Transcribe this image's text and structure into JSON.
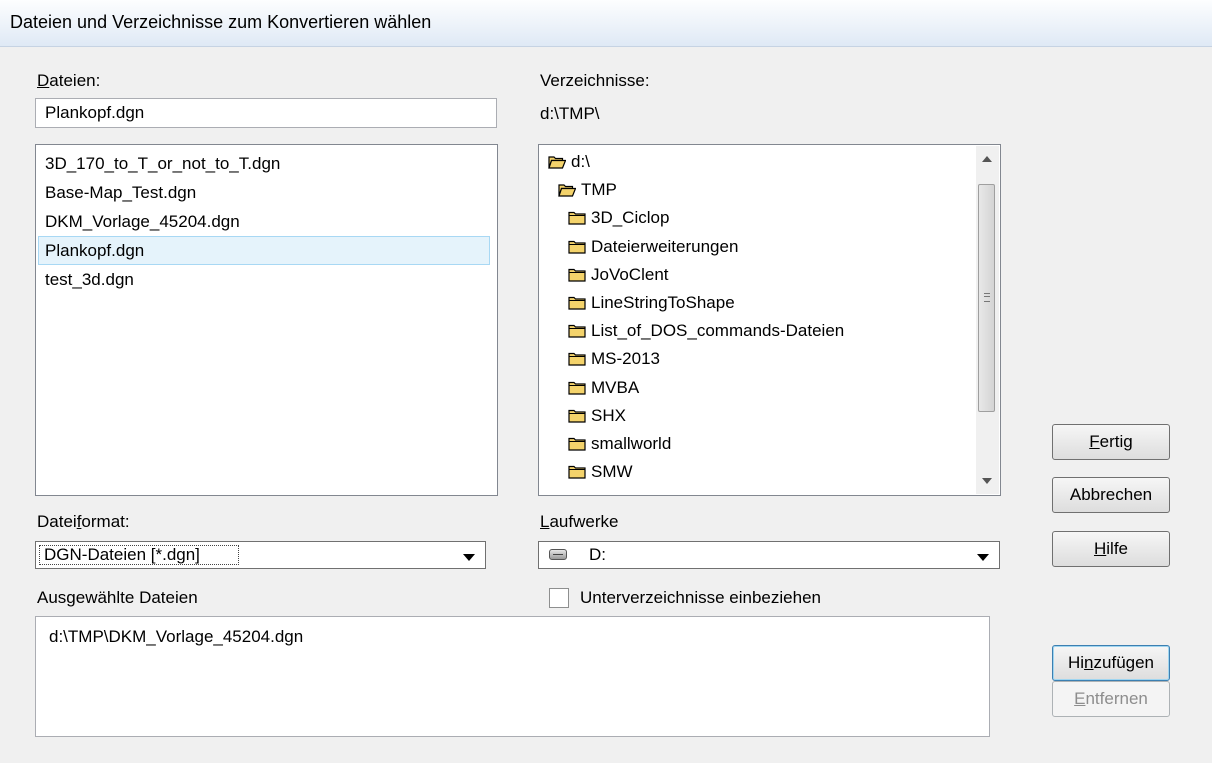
{
  "window": {
    "title": "Dateien und Verzeichnisse zum Konvertieren wählen"
  },
  "files": {
    "label_u": "D",
    "label_rest": "ateien:",
    "input_value": "Plankopf.dgn",
    "items": [
      "3D_170_to_T_or_not_to_T.dgn",
      "Base-Map_Test.dgn",
      "DKM_Vorlage_45204.dgn",
      "Plankopf.dgn",
      "test_3d.dgn"
    ],
    "selected_index": 3
  },
  "dirs": {
    "label": "Verzeichnisse:",
    "current_path": "d:\\TMP\\",
    "tree": [
      {
        "name": "d:\\",
        "icon": "folder-open-icon",
        "level": 0
      },
      {
        "name": "TMP",
        "icon": "folder-open-icon",
        "level": 1
      },
      {
        "name": "3D_Ciclop",
        "icon": "folder-icon",
        "level": 2
      },
      {
        "name": "Dateierweiterungen",
        "icon": "folder-icon",
        "level": 2
      },
      {
        "name": "JoVoClent",
        "icon": "folder-icon",
        "level": 2
      },
      {
        "name": "LineStringToShape",
        "icon": "folder-icon",
        "level": 2
      },
      {
        "name": "List_of_DOS_commands-Dateien",
        "icon": "folder-icon",
        "level": 2
      },
      {
        "name": "MS-2013",
        "icon": "folder-icon",
        "level": 2
      },
      {
        "name": "MVBA",
        "icon": "folder-icon",
        "level": 2
      },
      {
        "name": "SHX",
        "icon": "folder-icon",
        "level": 2
      },
      {
        "name": "smallworld",
        "icon": "folder-icon",
        "level": 2
      },
      {
        "name": "SMW",
        "icon": "folder-icon",
        "level": 2
      }
    ]
  },
  "format": {
    "label_a": "Datei",
    "label_u": "f",
    "label_b": "ormat:",
    "value": "DGN-Dateien [*.dgn]"
  },
  "drives": {
    "label_u": "L",
    "label_rest": "aufwerke",
    "value": "D:"
  },
  "selected_files": {
    "label": "Ausgewählte Dateien",
    "items": [
      "d:\\TMP\\DKM_Vorlage_45204.dgn"
    ]
  },
  "subdirs_checkbox": {
    "label": "Unterverzeichnisse einbeziehen",
    "checked": false
  },
  "buttons": {
    "fertig_u": "F",
    "fertig_rest": "ertig",
    "abbrechen": "Abbrechen",
    "hilfe_u": "H",
    "hilfe_rest": "ilfe",
    "hinzu_a": "Hi",
    "hinzu_u": "n",
    "hinzu_b": "zufügen",
    "entfernen_u": "E",
    "entfernen_rest": "ntfernen"
  },
  "colors": {
    "selection": "#e5f3fb",
    "folder": "#f4d36b"
  }
}
